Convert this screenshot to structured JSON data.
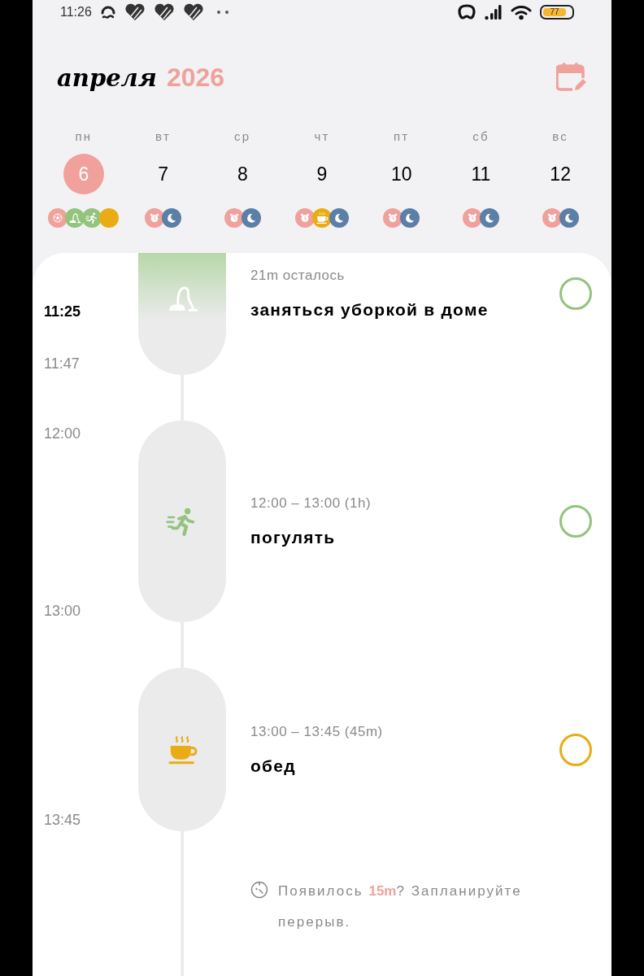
{
  "status_bar": {
    "time": "11:26",
    "battery": "77"
  },
  "header": {
    "month": "апреля",
    "year": "2026"
  },
  "days": [
    {
      "label": "пн",
      "date": "6",
      "selected": true,
      "events": [
        {
          "kind": "ball",
          "color": "#f0a19c"
        },
        {
          "kind": "vacuum",
          "color": "#93c47d"
        },
        {
          "kind": "runner",
          "color": "#93c47d"
        },
        {
          "kind": "plain",
          "color": "#e9ac14"
        }
      ]
    },
    {
      "label": "вт",
      "date": "7",
      "selected": false,
      "events": [
        {
          "kind": "alarm",
          "color": "#f0a19c"
        },
        {
          "kind": "moon",
          "color": "#5b7fa6"
        }
      ]
    },
    {
      "label": "ср",
      "date": "8",
      "selected": false,
      "events": [
        {
          "kind": "alarm",
          "color": "#f0a19c"
        },
        {
          "kind": "moon",
          "color": "#5b7fa6"
        }
      ]
    },
    {
      "label": "чт",
      "date": "9",
      "selected": false,
      "events": [
        {
          "kind": "alarm",
          "color": "#f0a19c"
        },
        {
          "kind": "cup",
          "color": "#e9ac14"
        },
        {
          "kind": "moon",
          "color": "#5b7fa6"
        }
      ]
    },
    {
      "label": "пт",
      "date": "10",
      "selected": false,
      "events": [
        {
          "kind": "alarm",
          "color": "#f0a19c"
        },
        {
          "kind": "moon",
          "color": "#5b7fa6"
        }
      ]
    },
    {
      "label": "сб",
      "date": "11",
      "selected": false,
      "events": [
        {
          "kind": "alarm",
          "color": "#f0a19c"
        },
        {
          "kind": "moon",
          "color": "#5b7fa6"
        }
      ]
    },
    {
      "label": "вс",
      "date": "12",
      "selected": false,
      "events": [
        {
          "kind": "alarm",
          "color": "#f0a19c"
        },
        {
          "kind": "moon",
          "color": "#5b7fa6"
        }
      ]
    }
  ],
  "timeline": [
    {
      "current": true,
      "times": [
        {
          "kind": "now",
          "text": "11:25"
        },
        {
          "kind": "end",
          "text": "11:47"
        }
      ],
      "kind": "vacuum",
      "color": "#93c47d",
      "subtitle": "21m осталось",
      "title": "заняться уборкой в доме",
      "done": false
    },
    {
      "current": false,
      "times": [
        {
          "kind": "start",
          "text": "12:00"
        },
        {
          "kind": "end",
          "text": "13:00"
        }
      ],
      "kind": "runner",
      "color": "#93c47d",
      "subtitle": "12:00 – 13:00 (1h)",
      "title": "погулять",
      "done": false
    },
    {
      "current": false,
      "times": [
        {
          "kind": "end",
          "text": "13:45"
        }
      ],
      "kind": "cup",
      "color": "#e9ac14",
      "subtitle": "13:00 – 13:45 (45m)",
      "title": "обед",
      "done": false
    }
  ],
  "note": {
    "text": "Появилось **15m**? Запланируйте перерыв."
  }
}
